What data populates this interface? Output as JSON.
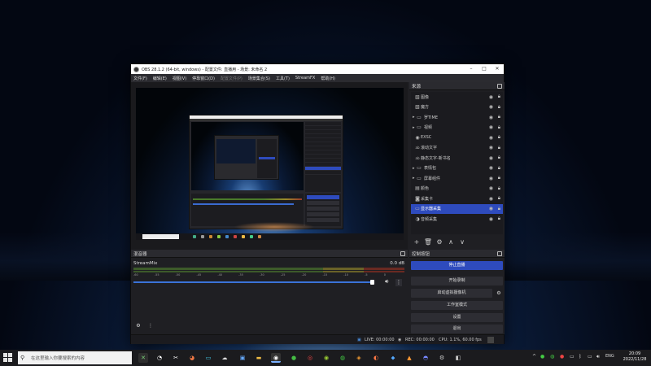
{
  "window": {
    "title": "OBS 28.1.2 (64-bit, windows) - 配置文件: 直播用 - 场景: 未命名 2",
    "controls": [
      "–",
      "□",
      "✕"
    ]
  },
  "menu": [
    "文件(F)",
    "编辑(E)",
    "视图(V)",
    "停靠窗口(D)",
    "配置文件(P)",
    "场景集合(S)",
    "工具(T)",
    "StreamFX",
    "帮助(H)"
  ],
  "sources": {
    "title": "来源",
    "items": [
      {
        "label": "图像",
        "icon": "image-icon",
        "group": false,
        "selected": false
      },
      {
        "label": "魔方",
        "icon": "image-icon",
        "group": false,
        "selected": false
      },
      {
        "label": "罗TIME",
        "icon": "folder-icon",
        "group": true,
        "selected": false
      },
      {
        "label": "视频",
        "icon": "folder-icon",
        "group": true,
        "selected": false
      },
      {
        "label": "EXSC",
        "icon": "obs-icon",
        "group": false,
        "selected": false
      },
      {
        "label": "滚动文字",
        "icon": "text-icon",
        "group": false,
        "selected": false
      },
      {
        "label": "静态文字-新书名",
        "icon": "text-icon",
        "group": false,
        "selected": false
      },
      {
        "label": "表情包",
        "icon": "folder-icon",
        "group": true,
        "selected": false
      },
      {
        "label": "屏幕组件",
        "icon": "folder-icon",
        "group": true,
        "selected": false
      },
      {
        "label": "颜色",
        "icon": "color-icon",
        "group": false,
        "selected": false
      },
      {
        "label": "采集卡",
        "icon": "camera-icon",
        "group": false,
        "selected": false
      },
      {
        "label": "显示器采集",
        "icon": "monitor-icon",
        "group": false,
        "selected": true
      },
      {
        "label": "音频采集",
        "icon": "gamepad-icon",
        "group": false,
        "selected": false
      }
    ],
    "tools": [
      "+",
      "🗑",
      "⚙",
      "∧",
      "∨"
    ]
  },
  "mixer": {
    "title": "混音器",
    "channel": "StreamMix",
    "db": "0.0 dB",
    "ticks": [
      "-60",
      "-55",
      "-50",
      "-45",
      "-40",
      "-35",
      "-30",
      "-25",
      "-20",
      "-15",
      "-10",
      "-5",
      "0"
    ],
    "volume_level": 0.96
  },
  "controls": {
    "title": "控制按钮",
    "buttons": [
      "停止直播",
      "开始录制",
      "启动虚拟摄像机",
      "工作室模式",
      "设置",
      "退出"
    ]
  },
  "status": {
    "live": "LIVE: 00:00:00",
    "rec": "REC: 00:00:00",
    "cpu": "CPU: 1.1%, 60.00 fps"
  },
  "taskbar": {
    "search_placeholder": "在这里输入你要搜索的内容",
    "lang": "ENG",
    "time": "20:09",
    "date": "2022/11/28"
  }
}
